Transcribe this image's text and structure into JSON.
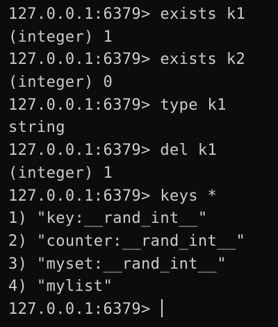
{
  "terminal": {
    "lines": [
      "127.0.0.1:6379> exists k1",
      "(integer) 1",
      "127.0.0.1:6379> exists k2",
      "(integer) 0",
      "127.0.0.1:6379> type k1",
      "string",
      "127.0.0.1:6379> del k1",
      "(integer) 1",
      "127.0.0.1:6379> keys *",
      "1) \"key:__rand_int__\"",
      "2) \"counter:__rand_int__\"",
      "3) \"myset:__rand_int__\"",
      "4) \"mylist\""
    ],
    "prompt": "127.0.0.1:6379> "
  },
  "colors": {
    "background": "#0c0c0c",
    "text": "#cccccc"
  }
}
